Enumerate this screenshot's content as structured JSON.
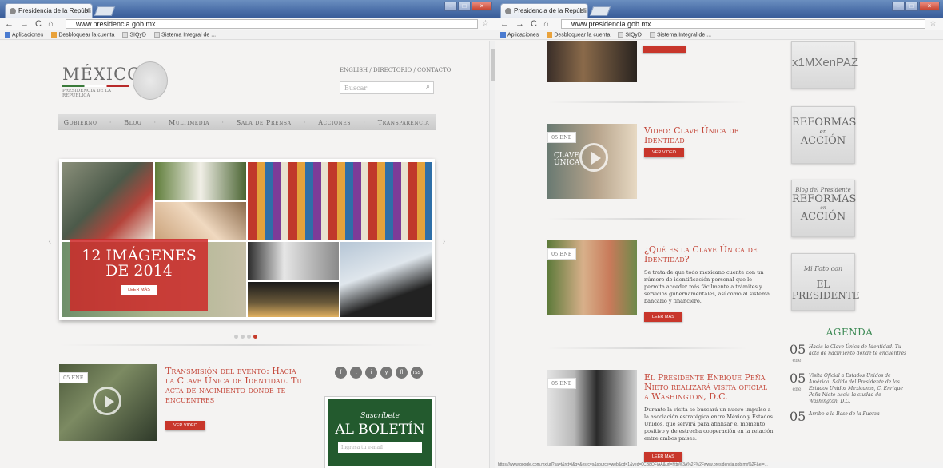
{
  "browser": {
    "tab_title": "Presidencia de la Repúbli",
    "url": "www.presidencia.gob.mx",
    "bookmarks": [
      "Aplicaciones",
      "Desbloquear la cuenta",
      "SIQyD",
      "Sistema Integral de ..."
    ]
  },
  "header": {
    "logo_title": "MÉXICO",
    "logo_subtitle": "PRESIDENCIA DE LA REPÚBLICA",
    "top_links": "ENGLISH / DIRECTORIO / CONTACTO",
    "search_placeholder": "Buscar"
  },
  "menu": [
    "Gobierno",
    "Blog",
    "Multimedia",
    "Sala de Prensa",
    "Acciones",
    "Transparencia"
  ],
  "slider": {
    "caption": "12 IMÁGENES DE 2014",
    "button": "LEER MÁS"
  },
  "news_left": {
    "date": "05 ENE",
    "title": "Transmisión del evento: Hacia la Clave Única de Identidad. Tu acta de nacimiento donde te encuentres",
    "button": "VER VIDEO"
  },
  "social_icons": [
    "f",
    "t",
    "i",
    "y",
    "fl",
    "rss"
  ],
  "newsletter": {
    "line1": "Suscríbete",
    "line2": "AL BOLETÍN",
    "input_placeholder": "Ingresa tu e-mail"
  },
  "news_right": [
    {
      "date": "05 ENE",
      "title": "Video: Clave Única de Identidad",
      "button": "VER VIDEO",
      "img_text": "CLAVE ÚNICA"
    },
    {
      "date": "05 ENE",
      "title": "¿Qué es la Clave Única de Identidad?",
      "body": "Se trata de que todo mexicano cuente con un número de identificación personal que le permita acceder más fácilmente a trámites y servicios gubernamentales, así como al sistema bancario y financiero.",
      "button": "LEER MÁS"
    },
    {
      "date": "05 ENE",
      "title": "El Presidente Enrique Peña Nieto realizará visita oficial a Washington, D.C.",
      "body": "Durante la visita se buscará un nuevo impulso a la asociación estratégica entre México y Estados Unidos, que servirá para afianzar el momento positivo y de estrecha cooperación en la relación entre ambos países.",
      "button": "LEER MÁS"
    }
  ],
  "sidebar_cards": {
    "mx": "x1MXenPAZ",
    "ref_top": "REFORMAS",
    "ref_en": "en",
    "ref_bottom": "ACCIÓN",
    "blog_top": "Blog del Presidente",
    "ref2_top": "REFORMAS",
    "ref2_en": "en",
    "ref2_bottom": "ACCIÓN",
    "foto_top": "Mi Foto con",
    "foto_bottom": "EL PRESIDENTE"
  },
  "agenda": {
    "heading": "AGENDA",
    "items": [
      {
        "day": "05",
        "month": "ene",
        "text": "Hacia la Clave Única de Identidad. Tu acta de nacimiento donde te encuentres"
      },
      {
        "day": "05",
        "month": "ene",
        "text": "Visita Oficial a Estados Unidos de América: Salida del Presidente de los Estados Unidos Mexicanos, C. Enrique Peña Nieto hacia la ciudad de Washington, D.C."
      },
      {
        "day": "05",
        "month": "",
        "text": "Arribo a la Base de la Fuerza"
      }
    ]
  },
  "status_url": "https://www.google.com.mx/url?sa=t&rct=j&q=&esrc=s&source=web&cd=1&ved=0CB8QFjAA&url=http%3A%2F%2Fwww.presidencia.gob.mx%2F&ei=..."
}
